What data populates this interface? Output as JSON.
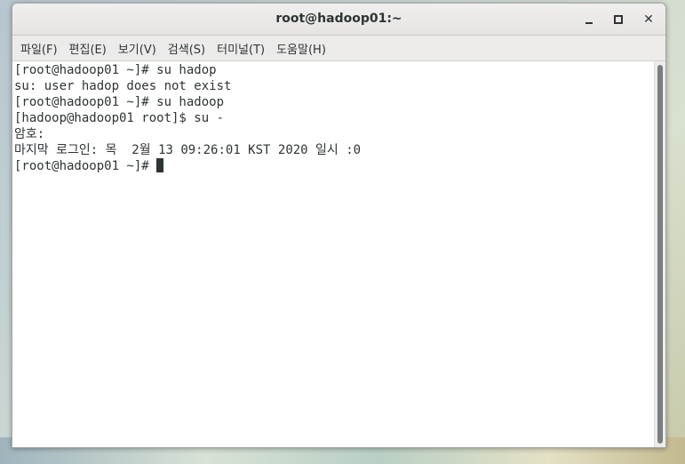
{
  "window": {
    "title": "root@hadoop01:~",
    "minimize_icon": "minimize-icon",
    "maximize_icon": "maximize-icon",
    "close_icon": "close-icon",
    "close_glyph": "✕"
  },
  "menu": {
    "items": [
      "파일(F)",
      "편집(E)",
      "보기(V)",
      "검색(S)",
      "터미널(T)",
      "도움말(H)"
    ]
  },
  "terminal": {
    "lines": [
      "[root@hadoop01 ~]# su hadop",
      "su: user hadop does not exist",
      "[root@hadoop01 ~]# su hadoop",
      "[hadoop@hadoop01 root]$ su -",
      "암호:",
      "마지막 로그인: 목  2월 13 09:26:01 KST 2020 일시 :0",
      "[root@hadoop01 ~]# "
    ]
  }
}
